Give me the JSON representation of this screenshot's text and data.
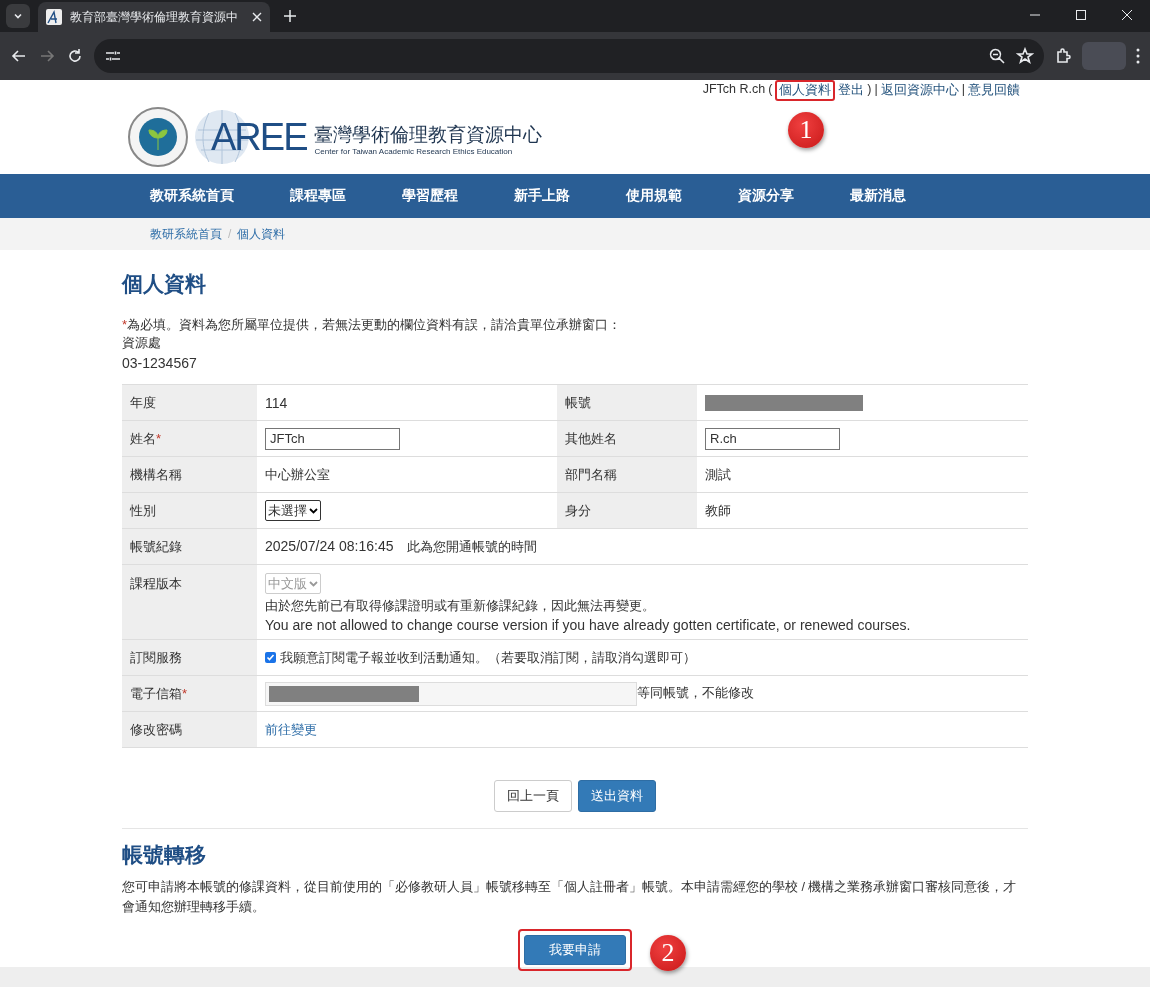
{
  "browser": {
    "tab_title": "教育部臺灣學術倫理教育資源中"
  },
  "user_links": [
    {
      "kind": "text",
      "text": "JFTch R.ch"
    },
    {
      "kind": "text",
      "text": "("
    },
    {
      "kind": "link",
      "text": "個人資料",
      "annotation": "1"
    },
    {
      "kind": "link",
      "text": "登出"
    },
    {
      "kind": "text",
      "text": ")"
    },
    {
      "kind": "text",
      "text": "|"
    },
    {
      "kind": "link",
      "text": "返回資源中心"
    },
    {
      "kind": "text",
      "text": "|"
    },
    {
      "kind": "link",
      "text": "意見回饋"
    }
  ],
  "site": {
    "logo_mark": "AREE",
    "title": "臺灣學術倫理教育資源中心",
    "subtitle": "Center for Taiwan Academic Research Ethics Education"
  },
  "nav": [
    {
      "label": "教研系統首頁"
    },
    {
      "label": "課程專區"
    },
    {
      "label": "學習歷程"
    },
    {
      "label": "新手上路"
    },
    {
      "label": "使用規範"
    },
    {
      "label": "資源分享"
    },
    {
      "label": "最新消息"
    }
  ],
  "breadcrumb": [
    {
      "label": "教研系統首頁"
    },
    {
      "label": "個人資料"
    }
  ],
  "breadcrumb_separator": "/",
  "page_title": "個人資料",
  "notice": {
    "mark": "*",
    "text": "為必填。資料為您所屬單位提供，若無法更動的欄位資料有誤，請洽貴單位承辦窗口：",
    "contact_unit": "資源處",
    "contact_phone": "03-1234567"
  },
  "form_rows": [
    {
      "cells": [
        {
          "kind": "label",
          "text": "年度"
        },
        {
          "kind": "text",
          "text": "114"
        },
        {
          "kind": "label",
          "text": "帳號"
        },
        {
          "kind": "redacted"
        }
      ]
    },
    {
      "cells": [
        {
          "kind": "label",
          "text": "姓名",
          "mark": "*"
        },
        {
          "kind": "input",
          "value": "JFTch"
        },
        {
          "kind": "label",
          "text": "其他姓名"
        },
        {
          "kind": "input",
          "value": "R.ch"
        }
      ]
    },
    {
      "cells": [
        {
          "kind": "label",
          "text": "機構名稱"
        },
        {
          "kind": "text",
          "text": "中心辦公室"
        },
        {
          "kind": "label",
          "text": "部門名稱"
        },
        {
          "kind": "text",
          "text": "測試"
        }
      ]
    },
    {
      "cells": [
        {
          "kind": "label",
          "text": "性別"
        },
        {
          "kind": "select",
          "value": "未選擇",
          "disabled": false
        },
        {
          "kind": "label",
          "text": "身分"
        },
        {
          "kind": "text",
          "text": "教師"
        }
      ]
    },
    {
      "cells": [
        {
          "kind": "label",
          "text": "帳號紀錄"
        },
        {
          "kind": "text",
          "text": "2025/07/24 08:16:45",
          "note": "此為您開通帳號的時間"
        }
      ]
    },
    {
      "cells": [
        {
          "kind": "label",
          "text": "課程版本"
        },
        {
          "kind": "select",
          "value": "中文版",
          "disabled": true,
          "notes": [
            "由於您先前已有取得修課證明或有重新修課紀錄，因此無法再變更。",
            "You are not allowed to change course version if you have already gotten certificate, or renewed courses."
          ]
        }
      ]
    },
    {
      "cells": [
        {
          "kind": "label",
          "text": "訂閱服務"
        },
        {
          "kind": "checkbox",
          "checked": true,
          "text": "我願意訂閱電子報並收到活動通知。（若要取消訂閱，請取消勾選即可）"
        }
      ]
    },
    {
      "cells": [
        {
          "kind": "label",
          "text": "電子信箱",
          "mark": "*"
        },
        {
          "kind": "email",
          "note": "等同帳號，不能修改"
        }
      ]
    },
    {
      "cells": [
        {
          "kind": "label",
          "text": "修改密碼"
        },
        {
          "kind": "link",
          "text": "前往變更"
        }
      ]
    }
  ],
  "form_buttons": [
    {
      "kind": "default",
      "label": "回上一頁"
    },
    {
      "kind": "primary",
      "label": "送出資料"
    }
  ],
  "transfer": {
    "title": "帳號轉移",
    "text": "您可申請將本帳號的修課資料，從目前使用的「必修教研人員」帳號移轉至「個人註冊者」帳號。本申請需經您的學校 / 機構之業務承辦窗口審核同意後，才會通知您辦理轉移手續。",
    "button": "我要申請",
    "annotation": "2"
  }
}
